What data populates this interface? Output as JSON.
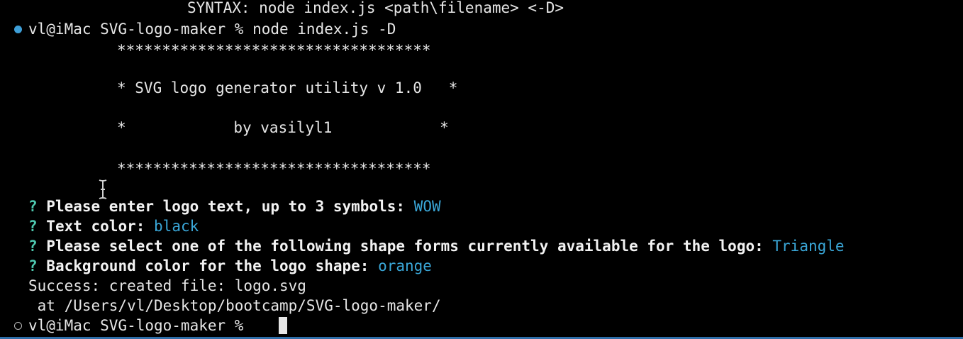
{
  "lines": {
    "syntax": "SYNTAX: node index.js <path\\filename> <-D>",
    "prompt1": "vl@iMac SVG-logo-maker % node index.js -D",
    "stars_top": "***********************************",
    "banner_title": "* SVG logo generator utility v 1.0   *",
    "banner_author": "*            by vasilyl1            *",
    "stars_bottom": "***********************************",
    "q1_mark": "?",
    "q1_text": " Please enter logo text, up to 3 symbols: ",
    "q1_answer": "WOW",
    "q2_mark": "?",
    "q2_text": " Text color: ",
    "q2_answer": "black",
    "q3_mark": "?",
    "q3_text": " Please select one of the following shape forms currently available for the logo: ",
    "q3_answer": "Triangle",
    "q4_mark": "?",
    "q4_text": " Background color for the logo shape: ",
    "q4_answer": "orange",
    "success": "Success: created file: logo.svg",
    "path": " at /Users/vl/Desktop/bootcamp/SVG-logo-maker/",
    "prompt2": "vl@iMac SVG-logo-maker % "
  },
  "colors": {
    "background": "#000000",
    "text": "#e6e6e6",
    "question_mark": "#4ec9b0",
    "answer": "#3aa7d8",
    "status_dot_active": "#3e9fd8"
  }
}
